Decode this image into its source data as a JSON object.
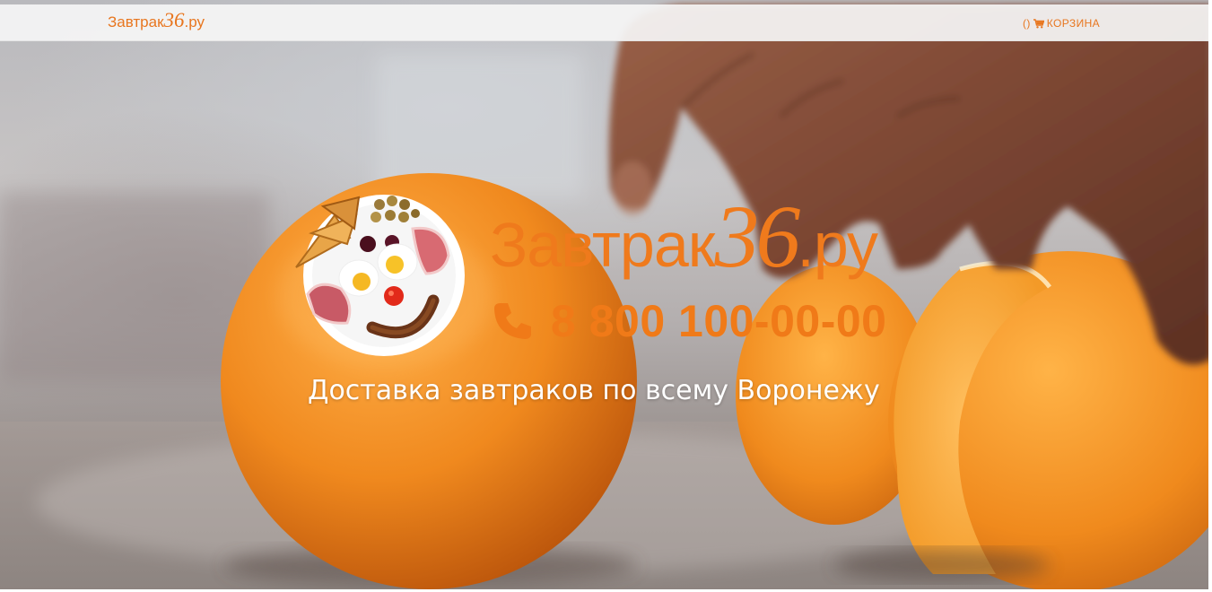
{
  "nav": {
    "logo_text_prefix": "Завтрак",
    "logo_text_number": "36",
    "logo_text_suffix": ".ру",
    "cart_count": "()",
    "cart_label": "КОРЗИНА"
  },
  "hero": {
    "brand_prefix": "Завтрак",
    "brand_number": "36",
    "brand_suffix": ".ру",
    "phone": "8 800 100-00-00",
    "tagline": "Доставка завтраков по всему Воронежу",
    "background_image": "oranges-being-cut-by-hand",
    "logo_image": "breakfast-plate-smiley-face"
  },
  "icons": {
    "cart": "cart-icon",
    "phone": "phone-icon"
  },
  "colors": {
    "accent": "#ef7a1c",
    "topbar": "#f5f5f5",
    "tagline": "#ffffff"
  }
}
